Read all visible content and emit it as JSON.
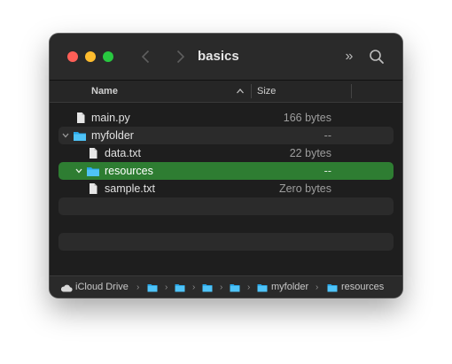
{
  "window": {
    "title": "basics"
  },
  "toolbar": {
    "back_icon": "chevron-left-icon",
    "forward_icon": "chevron-right-icon",
    "more_glyph": "»",
    "search_icon": "magnifying-glass-icon"
  },
  "columns": {
    "name": "Name",
    "size": "Size"
  },
  "files": [
    {
      "name": "main.py",
      "size": "166 bytes",
      "kind": "file",
      "expanded": null
    },
    {
      "name": "myfolder",
      "size": "--",
      "kind": "folder",
      "expanded": true
    },
    {
      "name": "data.txt",
      "size": "22 bytes",
      "kind": "file",
      "expanded": null
    },
    {
      "name": "resources",
      "size": "--",
      "kind": "folder",
      "expanded": true,
      "selected": true
    },
    {
      "name": "sample.txt",
      "size": "Zero bytes",
      "kind": "file",
      "expanded": null
    }
  ],
  "pathbar": {
    "root": "iCloud Drive",
    "folders": [
      "myfolder",
      "resources"
    ]
  },
  "colors": {
    "selection": "#2e7d32",
    "folder": "#29a7e8",
    "close": "#ff5f57",
    "minimize": "#febc2e",
    "maximize": "#28c840"
  }
}
